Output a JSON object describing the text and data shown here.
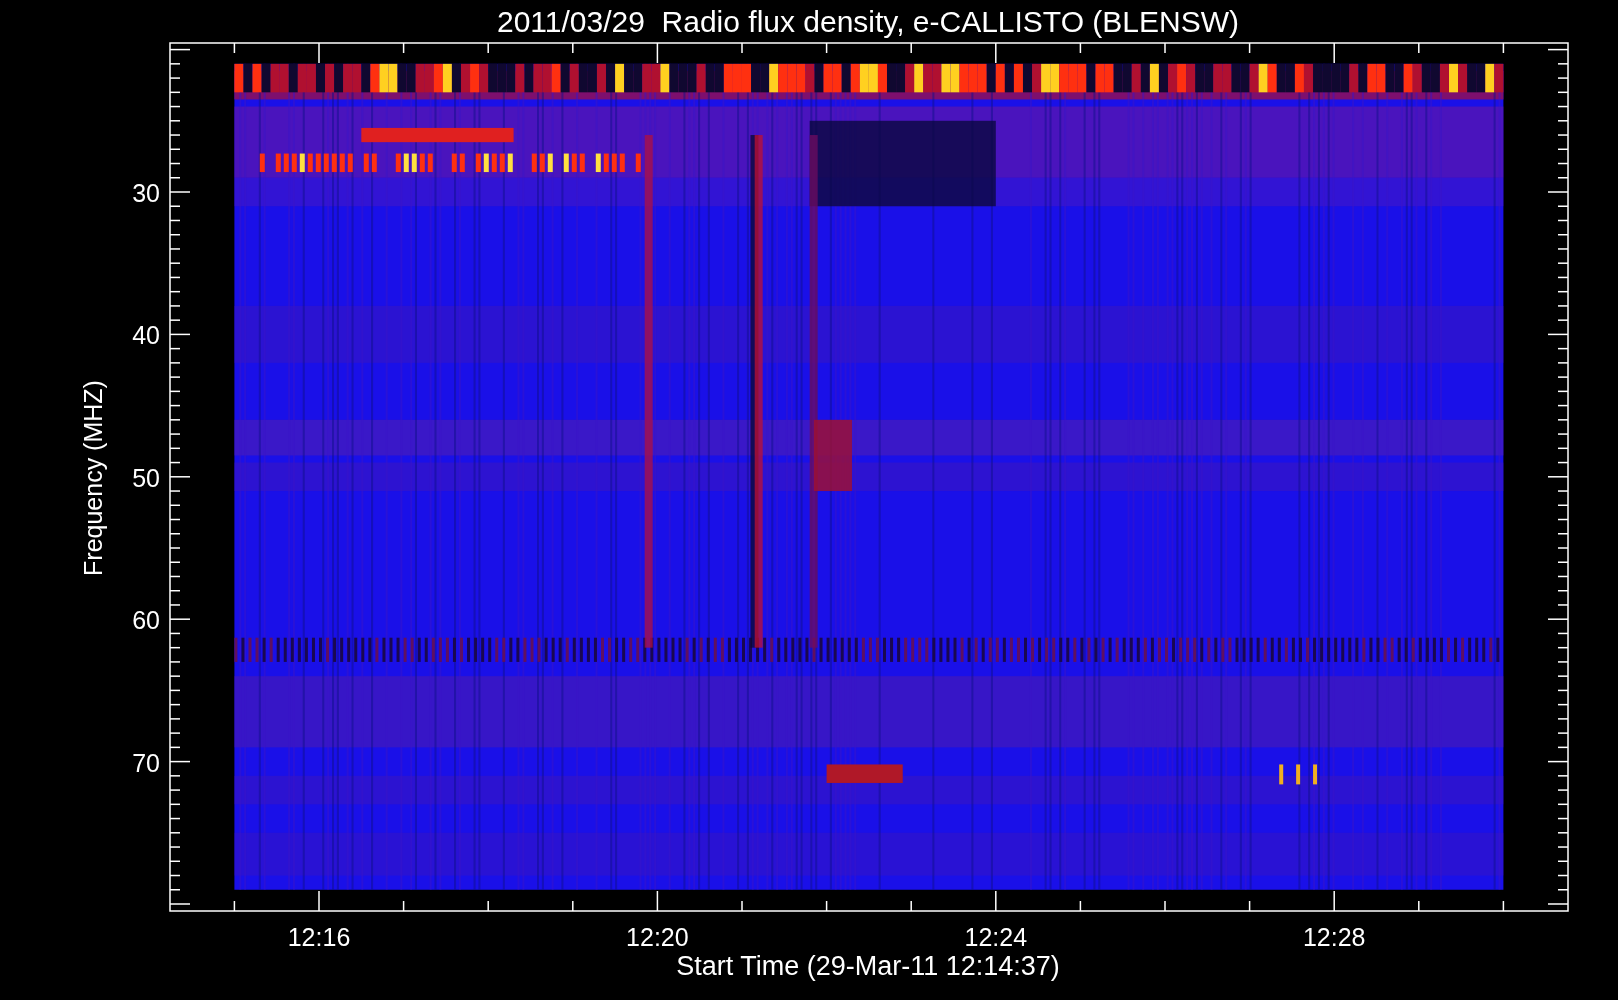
{
  "title": "2011/03/29  Radio flux density, e-CALLISTO (BLENSW)",
  "y_axis": {
    "label": "Frequency (MHZ)",
    "ticks": [
      "30",
      "40",
      "50",
      "60",
      "70"
    ]
  },
  "x_axis": {
    "label": "Start Time (29-Mar-11 12:14:37)",
    "ticks": [
      "12:16",
      "12:20",
      "12:24",
      "12:28"
    ]
  }
}
